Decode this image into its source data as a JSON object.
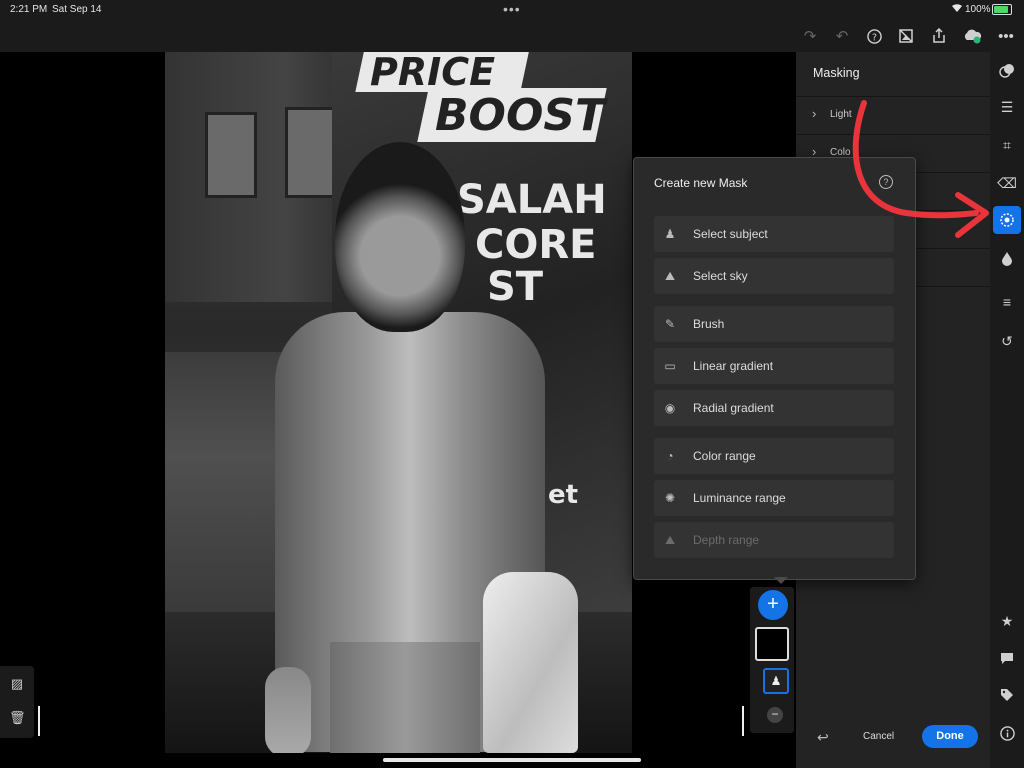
{
  "status": {
    "time": "2:21 PM",
    "date": "Sat Sep 14",
    "battery": "100%",
    "battery_level": 1.0
  },
  "photo": {
    "sign_line1": "PRICE",
    "sign_line2": "BOOST",
    "window_text1": "SALAH",
    "window_text2": "CORE",
    "window_text3": "ST",
    "window_text4": "et"
  },
  "panel": {
    "title": "Masking",
    "sections": [
      "Light",
      "Colo"
    ]
  },
  "popup": {
    "title": "Create new Mask",
    "options": [
      {
        "label": "Select subject",
        "icon": "select-subject-icon",
        "enabled": true
      },
      {
        "label": "Select sky",
        "icon": "select-sky-icon",
        "enabled": true
      },
      {
        "label": "Brush",
        "icon": "brush-icon",
        "enabled": true
      },
      {
        "label": "Linear gradient",
        "icon": "linear-gradient-icon",
        "enabled": true
      },
      {
        "label": "Radial gradient",
        "icon": "radial-gradient-icon",
        "enabled": true
      },
      {
        "label": "Color range",
        "icon": "color-range-icon",
        "enabled": true
      },
      {
        "label": "Luminance range",
        "icon": "luminance-range-icon",
        "enabled": true
      },
      {
        "label": "Depth range",
        "icon": "depth-range-icon",
        "enabled": false
      }
    ]
  },
  "actions": {
    "cancel": "Cancel",
    "done": "Done"
  },
  "colors": {
    "accent": "#1473e6",
    "annotation_arrow": "#e8343a",
    "panel_bg": "#232323",
    "popup_bg": "#2a2a2a"
  }
}
